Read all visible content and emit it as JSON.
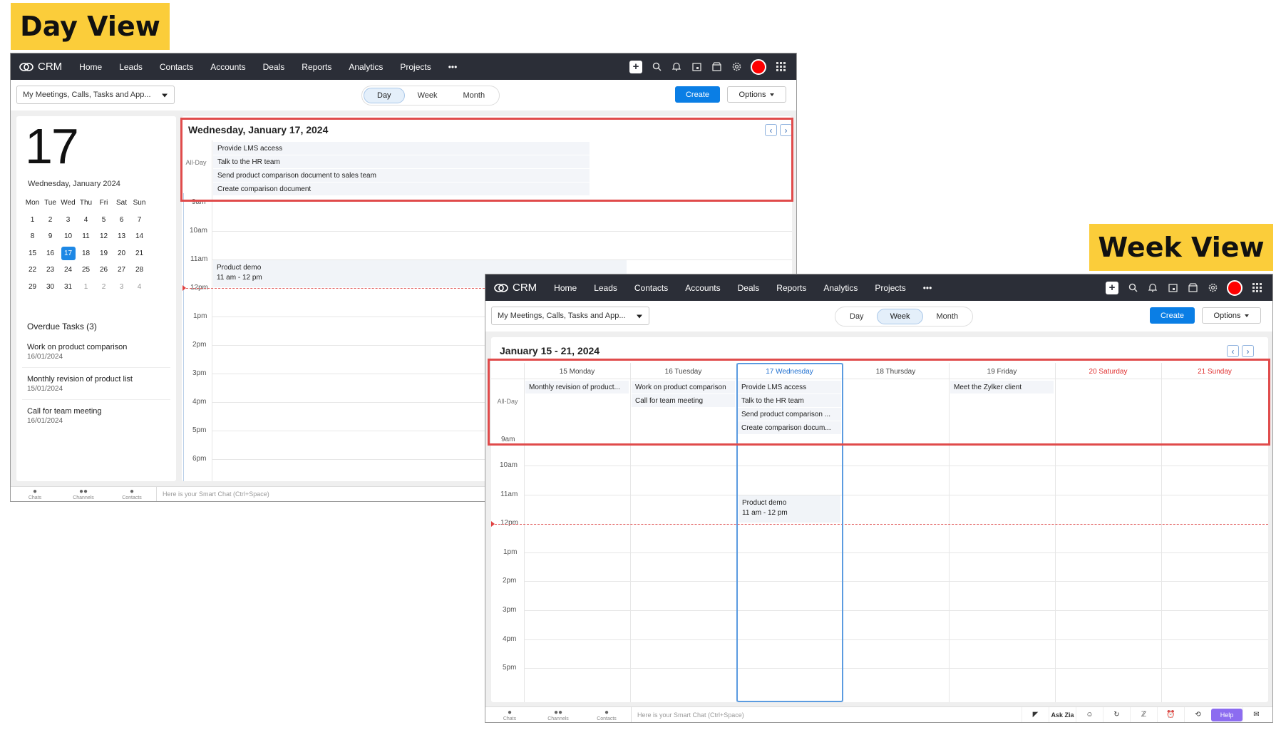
{
  "labels": {
    "day": "Day View",
    "week": "Week View"
  },
  "app": {
    "logo": "CRM",
    "nav": [
      "Home",
      "Leads",
      "Contacts",
      "Accounts",
      "Deals",
      "Reports",
      "Analytics",
      "Projects"
    ],
    "more": "•••",
    "filter": "My Meetings, Calls, Tasks and App...",
    "views": [
      "Day",
      "Week",
      "Month"
    ],
    "create": "Create",
    "options": "Options",
    "smart_chat": "Here is your Smart Chat (Ctrl+Space)",
    "bottom_tabs": [
      "Chats",
      "Channels",
      "Contacts"
    ],
    "colors": {
      "accent": "#0a7ee5",
      "topbar": "#2b2e37",
      "highlight": "#e04b4b",
      "label_bg": "#fbcd3a",
      "avatar": "#ff0000",
      "weekend": "#e03030"
    }
  },
  "day_view": {
    "big_day": "17",
    "date_sub": "Wednesday, January 2024",
    "mini_cal": {
      "headers": [
        "Mon",
        "Tue",
        "Wed",
        "Thu",
        "Fri",
        "Sat",
        "Sun"
      ],
      "weeks": [
        [
          "1",
          "2",
          "3",
          "4",
          "5",
          "6",
          "7"
        ],
        [
          "8",
          "9",
          "10",
          "11",
          "12",
          "13",
          "14"
        ],
        [
          "15",
          "16",
          "17",
          "18",
          "19",
          "20",
          "21"
        ],
        [
          "22",
          "23",
          "24",
          "25",
          "26",
          "27",
          "28"
        ],
        [
          "29",
          "30",
          "31",
          "1",
          "2",
          "3",
          "4"
        ]
      ],
      "selected": "17"
    },
    "overdue_title": "Overdue Tasks (3)",
    "overdue": [
      {
        "name": "Work on product comparison",
        "date": "16/01/2024"
      },
      {
        "name": "Monthly revision of product list",
        "date": "15/01/2024"
      },
      {
        "name": "Call for team meeting",
        "date": "16/01/2024"
      }
    ],
    "title": "Wednesday, January 17, 2024",
    "allday_label": "All-Day",
    "allday_events": [
      "Provide LMS access",
      "Talk to the HR team",
      "Send product comparison document to sales team",
      "Create comparison document"
    ],
    "hours": [
      "9am",
      "10am",
      "11am",
      "12pm",
      "1pm",
      "2pm",
      "3pm",
      "4pm",
      "5pm",
      "6pm"
    ],
    "event": {
      "title": "Product demo",
      "time": "11 am - 12 pm"
    }
  },
  "week_view": {
    "title": "January 15 - 21, 2024",
    "allday_label": "All-Day",
    "days": [
      "15 Monday",
      "16 Tuesday",
      "17 Wednesday",
      "18 Thursday",
      "19 Friday",
      "20 Saturday",
      "21 Sunday"
    ],
    "allday_events": {
      "mon": [
        "Monthly revision of product..."
      ],
      "tue": [
        "Work on product comparison",
        "Call for team meeting"
      ],
      "wed": [
        "Provide LMS access",
        "Talk to the HR team",
        "Send product comparison ...",
        "Create comparison docum..."
      ],
      "fri": [
        "Meet the Zylker client"
      ]
    },
    "hours": [
      "9am",
      "10am",
      "11am",
      "12pm",
      "1pm",
      "2pm",
      "3pm",
      "4pm",
      "5pm"
    ],
    "event": {
      "title": "Product demo",
      "time": "11 am - 12 pm"
    },
    "bottom_right": [
      "Ask Zia",
      "Help"
    ]
  }
}
